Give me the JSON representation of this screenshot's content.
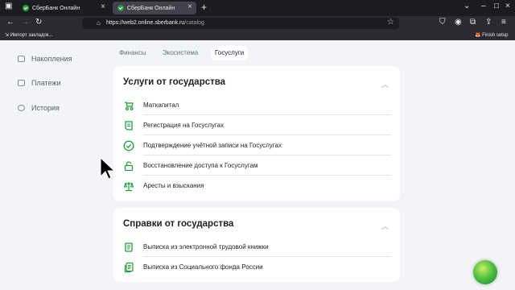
{
  "browser": {
    "tabs": [
      {
        "title": "СберБанк Онлайн"
      },
      {
        "title": "СберБанк Онлайн"
      }
    ],
    "url_host": "https://web2.online.sberbank.ru",
    "url_path": "/catalog",
    "bookmarks": {
      "left": "Импорт закладок...",
      "right": "Finish setup"
    }
  },
  "sidebar": {
    "items": [
      {
        "label": "Накопления"
      },
      {
        "label": "Платежи"
      },
      {
        "label": "История"
      }
    ]
  },
  "category_tabs": [
    {
      "label": "Финансы"
    },
    {
      "label": "Экосистема"
    },
    {
      "label": "Госуслуги"
    }
  ],
  "sections": [
    {
      "title": "Услуги от государства",
      "items": [
        {
          "label": "Маткапитал",
          "icon": "stroller-icon"
        },
        {
          "label": "Регистрация на Госуслугах",
          "icon": "gosuslugi-icon"
        },
        {
          "label": "Подтверждение учётной записи на Госуслугах",
          "icon": "check-circle-icon"
        },
        {
          "label": "Восстановление доступа к Госуслугам",
          "icon": "unlock-icon"
        },
        {
          "label": "Аресты и взыскания",
          "icon": "scales-icon"
        }
      ]
    },
    {
      "title": "Справки от государства",
      "items": [
        {
          "label": "Выписка из электронной трудовой книжки",
          "icon": "document-icon"
        },
        {
          "label": "Выписка из Социального фонда России",
          "icon": "documents-icon"
        }
      ]
    }
  ],
  "colors": {
    "accent": "#21a038",
    "background": "#f2f4f7",
    "card": "#ffffff"
  }
}
